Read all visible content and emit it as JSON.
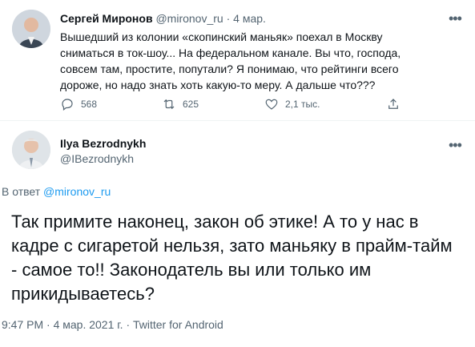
{
  "tweet1": {
    "author": "Сергей Миронов",
    "handle": "@mironov_ru",
    "sep": "·",
    "date": "4 мар.",
    "text": "Вышедший из колонии «скопинский маньяк» поехал в Москву сниматься в ток-шоу... На федеральном канале. Вы что, господа, совсем там, простите, попутали? Я понимаю, что рейтинги всего дороже, но надо знать хоть какую-то меру. А дальше что???",
    "replies": "568",
    "retweets": "625",
    "likes": "2,1 тыс.",
    "avatar_icon": "user-photo-icon"
  },
  "tweet2": {
    "author": "Ilya Bezrodnykh",
    "handle": "@IBezrodnykh",
    "reply_prefix": "В ответ",
    "reply_to": "@mironov_ru",
    "text": "Так примите наконец, закон об этике! А то у нас в кадре с сигаретой нельзя, зато маньяку в прайм-тайм - самое то!! Законодатель вы или только им прикидываетесь?",
    "meta": "9:47 PM · 4 мар. 2021 г. · Twitter for Android",
    "avatar_icon": "user-photo-icon"
  },
  "colors": {
    "accent": "#1d9bf0",
    "muted": "#536471",
    "text": "#0f1419"
  }
}
